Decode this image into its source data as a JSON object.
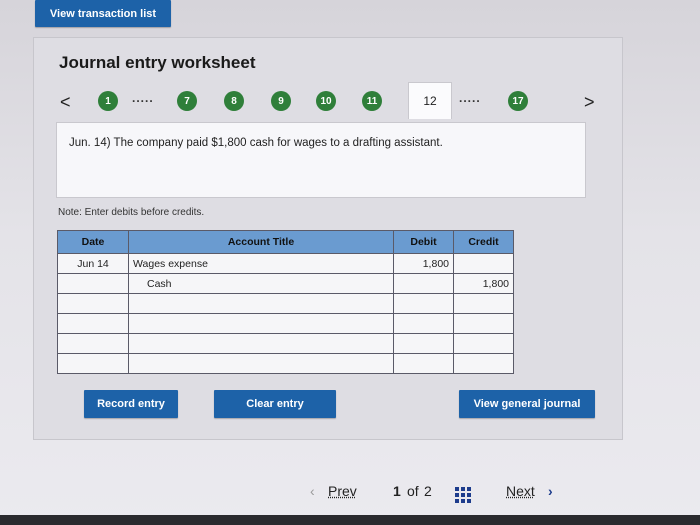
{
  "header": {
    "view_transaction_list": "View transaction list"
  },
  "worksheet": {
    "title": "Journal entry worksheet",
    "nav": {
      "prev_arrow": "<",
      "next_arrow": ">",
      "tabs": [
        "1",
        "7",
        "8",
        "9",
        "10",
        "11",
        "12",
        "17"
      ],
      "current": "12",
      "dots": "....."
    },
    "question": "Jun. 14) The company paid $1,800 cash for wages to a drafting assistant.",
    "note": "Note: Enter debits before credits.",
    "table": {
      "headers": {
        "date": "Date",
        "account": "Account Title",
        "debit": "Debit",
        "credit": "Credit"
      },
      "rows": [
        {
          "date": "Jun 14",
          "account": "Wages expense",
          "debit": "1,800",
          "credit": ""
        },
        {
          "date": "",
          "account": "Cash",
          "debit": "",
          "credit": "1,800"
        },
        {
          "date": "",
          "account": "",
          "debit": "",
          "credit": ""
        },
        {
          "date": "",
          "account": "",
          "debit": "",
          "credit": ""
        },
        {
          "date": "",
          "account": "",
          "debit": "",
          "credit": ""
        },
        {
          "date": "",
          "account": "",
          "debit": "",
          "credit": ""
        }
      ]
    },
    "buttons": {
      "record_entry": "Record entry",
      "clear_entry": "Clear entry",
      "view_general_journal": "View general journal"
    }
  },
  "pagination": {
    "prev": "Prev",
    "page_current": "1",
    "of": "of",
    "page_total": "2",
    "next": "Next",
    "prev_icon": "chevron-left-icon",
    "next_icon": "chevron-right-icon",
    "grid_icon": "grid-icon"
  },
  "colors": {
    "button_blue": "#1d62a8",
    "tab_green": "#2f7f3a",
    "table_header": "#6a9bd0"
  }
}
